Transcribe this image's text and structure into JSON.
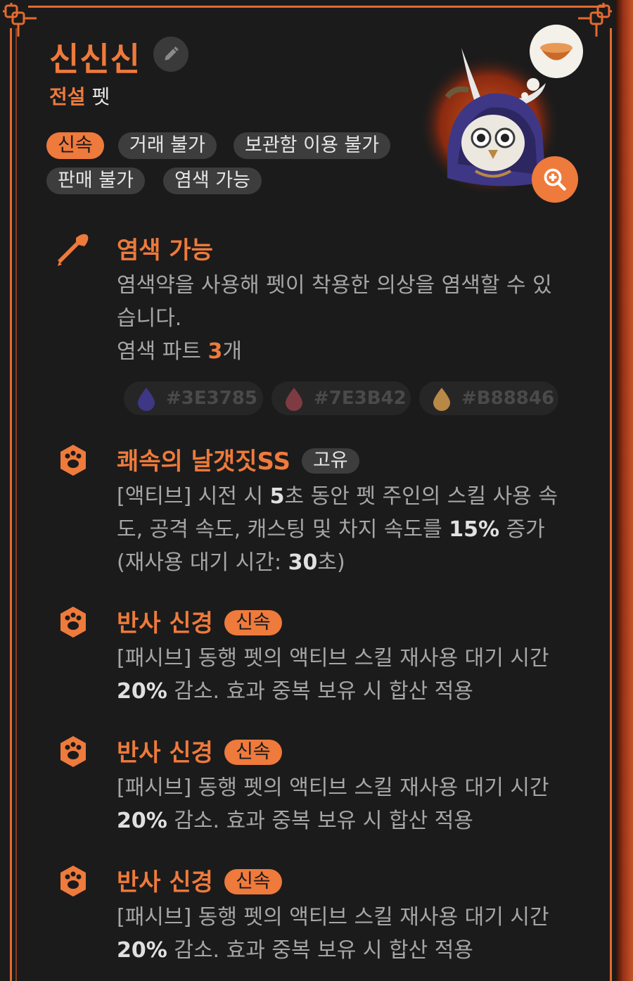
{
  "pet": {
    "name": "신신신",
    "rarity_grade": "전설",
    "rarity_type": "펫"
  },
  "tags": [
    "신속",
    "거래 불가",
    "보관함 이용 불가",
    "판매 불가",
    "염색 가능"
  ],
  "icons": {
    "edit": "pencil-icon",
    "zoom": "zoom-in-icon",
    "dye": "dye-brush-icon",
    "skill": "paw-icon"
  },
  "dye_section": {
    "title": "염색 가능",
    "desc_line": "염색약을 사용해 펫이 착용한 의상을 염색할 수 있습니다.",
    "parts_prefix": "염색 파트 ",
    "parts_count": "3",
    "parts_suffix": "개",
    "colors": [
      "#3E3785",
      "#7E3B42",
      "#B88846"
    ]
  },
  "skills": [
    {
      "title": "쾌속의 날갯짓SS",
      "badge": "고유",
      "badge_style": "gray",
      "desc": [
        {
          "t": "[액티브] 시전 시 "
        },
        {
          "t": "5",
          "b": true
        },
        {
          "t": "초 동안 펫 주인의 스킬 사용 속도, 공격 속도, 캐스팅 및 차지 속도를 "
        },
        {
          "t": "15%",
          "b": true
        },
        {
          "t": " 증가 (재사용 대기 시간: "
        },
        {
          "t": "30",
          "b": true
        },
        {
          "t": "초)"
        }
      ]
    },
    {
      "title": "반사 신경",
      "badge": "신속",
      "badge_style": "orange",
      "desc": [
        {
          "t": "[패시브] 동행 펫의 액티브 스킬 재사용 대기 시간 "
        },
        {
          "t": "20%",
          "b": true
        },
        {
          "t": " 감소. 효과 중복 보유 시 합산 적용"
        }
      ]
    },
    {
      "title": "반사 신경",
      "badge": "신속",
      "badge_style": "orange",
      "desc": [
        {
          "t": "[패시브] 동행 펫의 액티브 스킬 재사용 대기 시간 "
        },
        {
          "t": "20%",
          "b": true
        },
        {
          "t": " 감소. 효과 중복 보유 시 합산 적용"
        }
      ]
    },
    {
      "title": "반사 신경",
      "badge": "신속",
      "badge_style": "orange",
      "desc": [
        {
          "t": "[패시브] 동행 펫의 액티브 스킬 재사용 대기 시간 "
        },
        {
          "t": "20%",
          "b": true
        },
        {
          "t": " 감소. 효과 중복 보유 시 합산 적용"
        }
      ]
    }
  ],
  "colors": {
    "accent": "#EE7A3C",
    "background": "#1B1B1B",
    "tag_bg": "#3D3D3D",
    "text_muted": "#A6A6A6"
  }
}
